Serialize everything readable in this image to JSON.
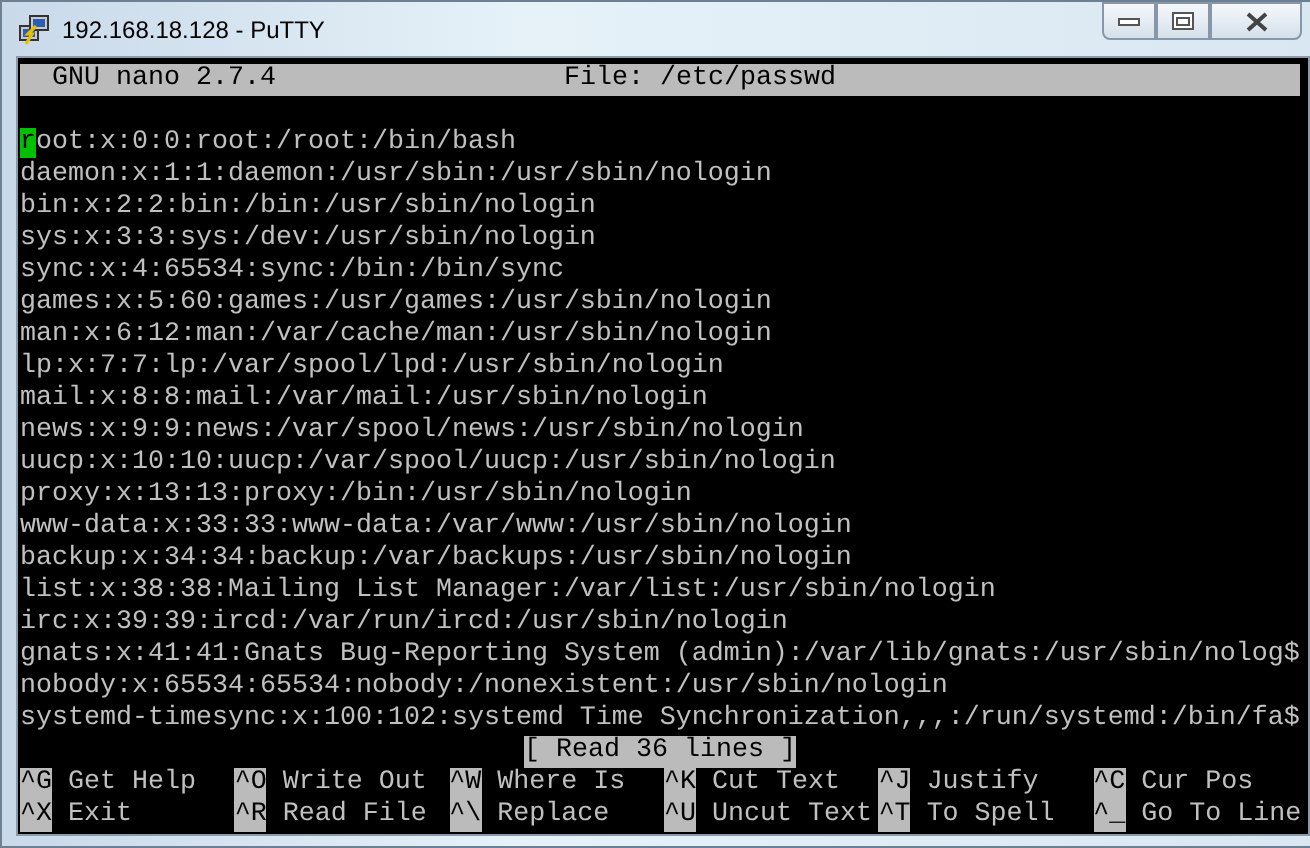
{
  "window": {
    "title": "192.168.18.128 - PuTTY"
  },
  "header": {
    "app": "GNU nano 2.7.4",
    "file": "File: /etc/passwd"
  },
  "lines": [
    {
      "text": "root:x:0:0:root:/root:/bin/bash",
      "cursor": true
    },
    {
      "text": "daemon:x:1:1:daemon:/usr/sbin:/usr/sbin/nologin",
      "cursor": false
    },
    {
      "text": "bin:x:2:2:bin:/bin:/usr/sbin/nologin",
      "cursor": false
    },
    {
      "text": "sys:x:3:3:sys:/dev:/usr/sbin/nologin",
      "cursor": false
    },
    {
      "text": "sync:x:4:65534:sync:/bin:/bin/sync",
      "cursor": false
    },
    {
      "text": "games:x:5:60:games:/usr/games:/usr/sbin/nologin",
      "cursor": false
    },
    {
      "text": "man:x:6:12:man:/var/cache/man:/usr/sbin/nologin",
      "cursor": false
    },
    {
      "text": "lp:x:7:7:lp:/var/spool/lpd:/usr/sbin/nologin",
      "cursor": false
    },
    {
      "text": "mail:x:8:8:mail:/var/mail:/usr/sbin/nologin",
      "cursor": false
    },
    {
      "text": "news:x:9:9:news:/var/spool/news:/usr/sbin/nologin",
      "cursor": false
    },
    {
      "text": "uucp:x:10:10:uucp:/var/spool/uucp:/usr/sbin/nologin",
      "cursor": false
    },
    {
      "text": "proxy:x:13:13:proxy:/bin:/usr/sbin/nologin",
      "cursor": false
    },
    {
      "text": "www-data:x:33:33:www-data:/var/www:/usr/sbin/nologin",
      "cursor": false
    },
    {
      "text": "backup:x:34:34:backup:/var/backups:/usr/sbin/nologin",
      "cursor": false
    },
    {
      "text": "list:x:38:38:Mailing List Manager:/var/list:/usr/sbin/nologin",
      "cursor": false
    },
    {
      "text": "irc:x:39:39:ircd:/var/run/ircd:/usr/sbin/nologin",
      "cursor": false
    },
    {
      "text": "gnats:x:41:41:Gnats Bug-Reporting System (admin):/var/lib/gnats:/usr/sbin/nolog$",
      "cursor": false
    },
    {
      "text": "nobody:x:65534:65534:nobody:/nonexistent:/usr/sbin/nologin",
      "cursor": false
    },
    {
      "text": "systemd-timesync:x:100:102:systemd Time Synchronization,,,:/run/systemd:/bin/fa$",
      "cursor": false
    }
  ],
  "status": "[ Read 36 lines ]",
  "shortcuts": [
    [
      {
        "key": "^G",
        "label": "Get Help"
      },
      {
        "key": "^O",
        "label": "Write Out"
      },
      {
        "key": "^W",
        "label": "Where Is"
      },
      {
        "key": "^K",
        "label": "Cut Text"
      },
      {
        "key": "^J",
        "label": "Justify"
      },
      {
        "key": "^C",
        "label": "Cur Pos"
      }
    ],
    [
      {
        "key": "^X",
        "label": "Exit"
      },
      {
        "key": "^R",
        "label": "Read File"
      },
      {
        "key": "^\\",
        "label": "Replace"
      },
      {
        "key": "^U",
        "label": "Uncut Text"
      },
      {
        "key": "^T",
        "label": "To Spell"
      },
      {
        "key": "^_",
        "label": "Go To Line"
      }
    ]
  ]
}
